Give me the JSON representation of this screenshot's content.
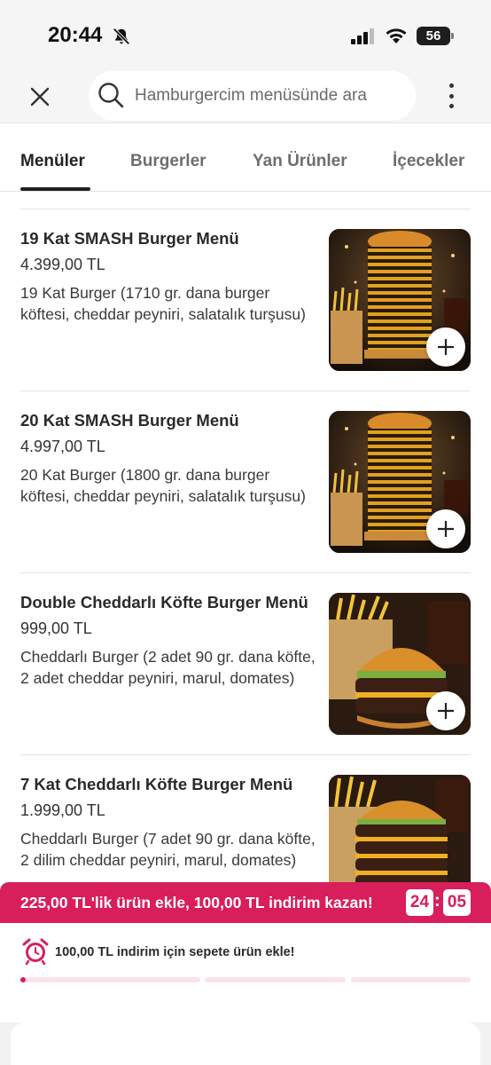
{
  "status_bar": {
    "time": "20:44",
    "battery": "56"
  },
  "search": {
    "placeholder": "Hamburgercim menüsünde ara"
  },
  "tabs": [
    {
      "label": "Menüler",
      "active": true
    },
    {
      "label": "Burgerler",
      "active": false
    },
    {
      "label": "Yan Ürünler",
      "active": false
    },
    {
      "label": "İçecekler",
      "active": false
    }
  ],
  "items": [
    {
      "name": "19 Kat SMASH  Burger Menü",
      "price": "4.399,00 TL",
      "description": "19 Kat Burger (1710 gr. dana burger köftesi, cheddar peyniri, salatalık turşusu)"
    },
    {
      "name": "20 Kat SMASH  Burger Menü",
      "price": "4.997,00 TL",
      "description": "20 Kat Burger (1800 gr. dana burger köftesi, cheddar peyniri, salatalık turşusu)"
    },
    {
      "name": "Double Cheddarlı Köfte Burger Menü",
      "price": "999,00 TL",
      "description": "Cheddarlı Burger (2 adet 90 gr. dana köfte, 2 adet cheddar peyniri, marul, domates)"
    },
    {
      "name": "7 Kat Cheddarlı Köfte Burger Menü",
      "price": "1.999,00 TL",
      "description": "Cheddarlı Burger (7 adet 90 gr. dana köfte, 2 dilim cheddar peyniri, marul, domates)"
    }
  ],
  "promo": {
    "text": "225,00 TL'lik ürün ekle, 100,00 TL indirim kazan!",
    "timer_hours": "24",
    "timer_separator": ":",
    "timer_minutes": "05"
  },
  "notice": {
    "text": "100,00 TL indirim için sepete ürün ekle!",
    "progress_fraction": 0.02
  },
  "colors": {
    "accent": "#d81e5b",
    "progress_track": "#fbe3ec"
  }
}
